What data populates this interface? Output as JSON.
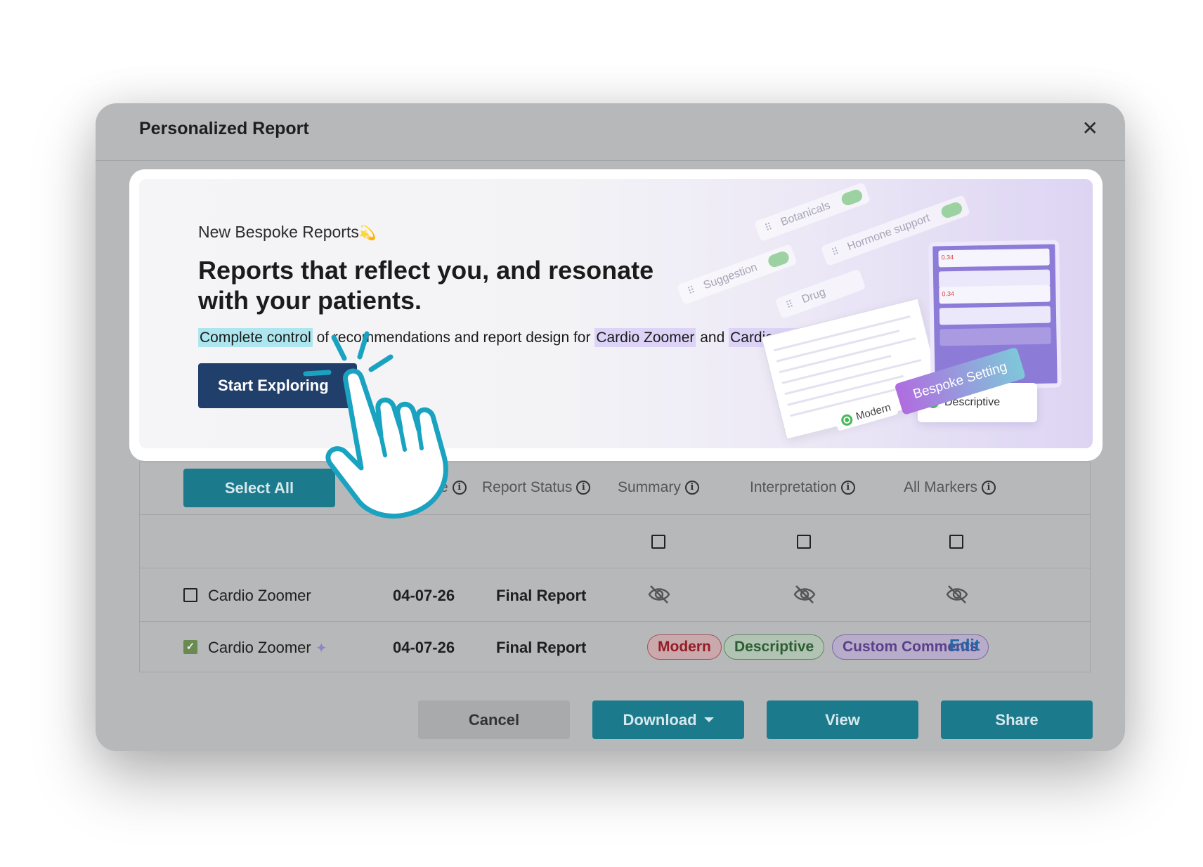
{
  "modal": {
    "title": "Personalized Report",
    "close_icon": "close-icon"
  },
  "banner": {
    "eyebrow": "New Bespoke Reports",
    "headline_line1": "Reports that reflect you, and resonate",
    "headline_line2": "with your patients.",
    "sub_hl1": "Complete control",
    "sub_text1": " of recommendations and report design for ",
    "sub_hl2": "Cardio Zoomer",
    "sub_text2": " and ",
    "sub_hl3": "Cardio Genetics",
    "cta": "Start Exploring",
    "deco": {
      "pills": [
        "Botanicals",
        "Hormone support",
        "Suggestion",
        "Drug"
      ],
      "descriptive": "Descriptive",
      "bespoke": "Bespoke Setting",
      "modern": "Modern",
      "value_a": "0.34",
      "value_b": "0.34"
    }
  },
  "table": {
    "select_all": "Select All",
    "headers": {
      "date": "e",
      "report_status": "Report Status",
      "summary": "Summary",
      "interpretation": "Interpretation",
      "all_markers": "All Markers"
    },
    "rows": [
      {
        "name": "Cardio Zoomer",
        "date": "04-07-26",
        "status": "Final Report",
        "checked": false
      },
      {
        "name": "Cardio Zoomer",
        "date": "04-07-26",
        "status": "Final Report",
        "checked": true,
        "tags": [
          "Modern",
          "Descriptive",
          "Custom Comments"
        ],
        "action": "Edit"
      }
    ]
  },
  "footer": {
    "cancel": "Cancel",
    "download": "Download",
    "view": "View",
    "share": "Share"
  },
  "colors": {
    "primary": "#1b7a8c",
    "cta": "#213f6b",
    "cursor": "#1aa3c1"
  }
}
